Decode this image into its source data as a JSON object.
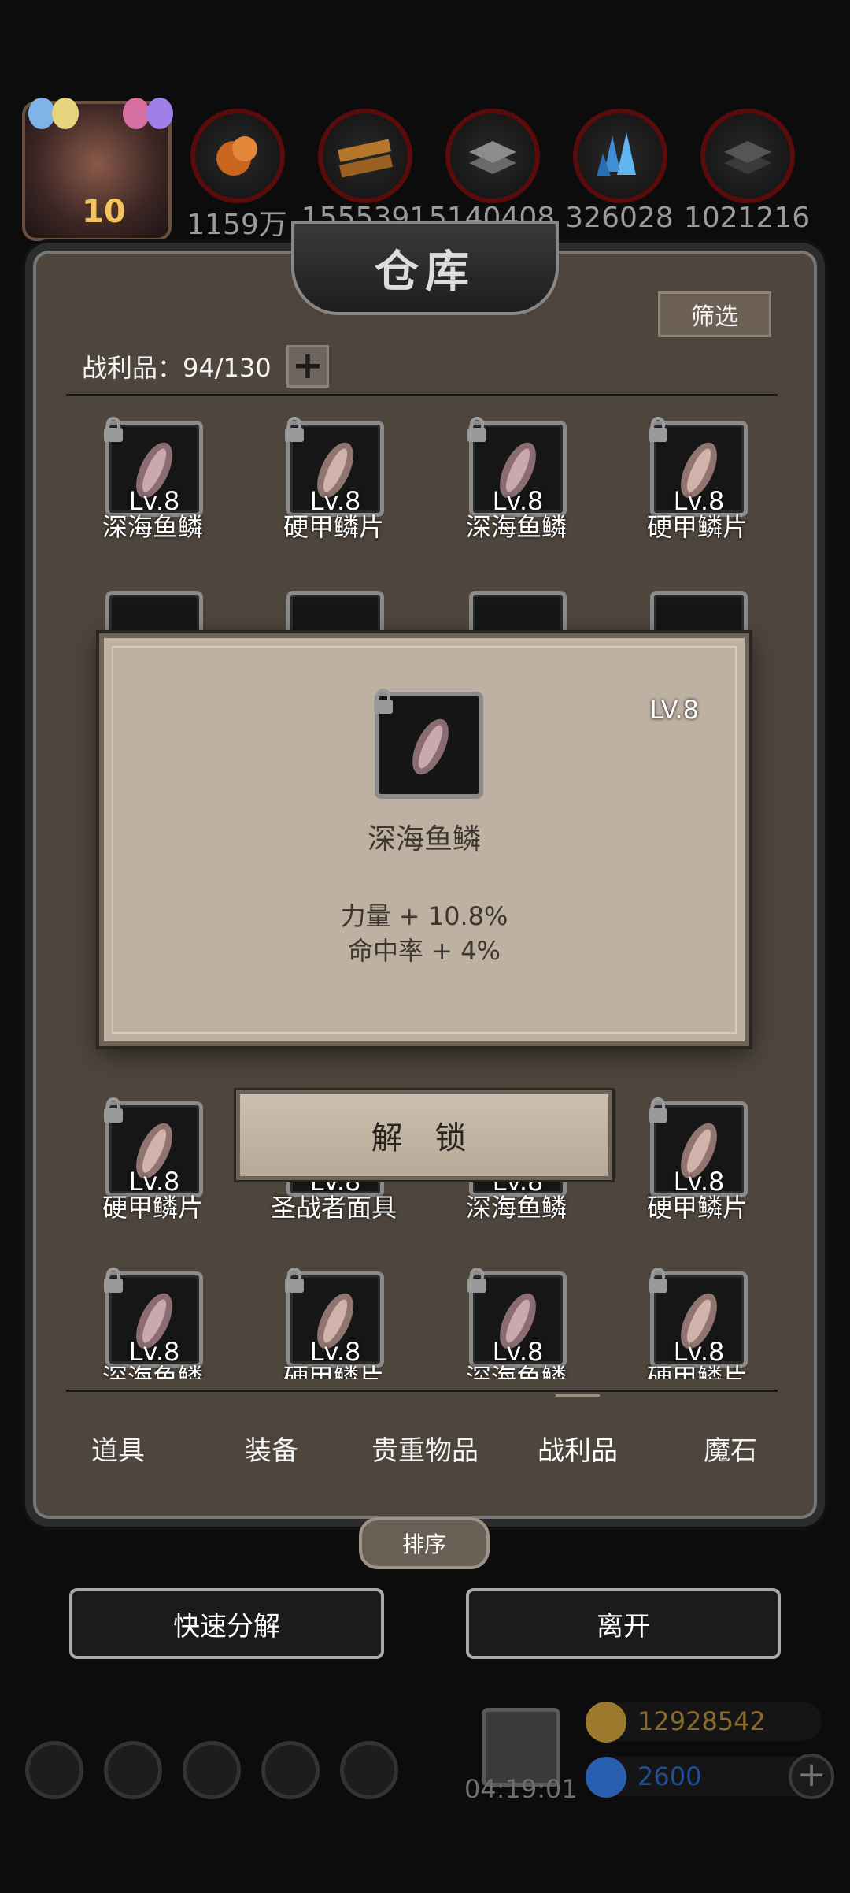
{
  "header": {
    "avatar_level": "10",
    "resources": [
      {
        "icon": "ore-orange-icon",
        "value": "1159万"
      },
      {
        "icon": "wood-planks-icon",
        "value": "1555391"
      },
      {
        "icon": "iron-ingot-icon",
        "value": "5140408"
      },
      {
        "icon": "blue-crystal-icon",
        "value": "326028"
      },
      {
        "icon": "dark-ingot-icon",
        "value": "1021216"
      }
    ]
  },
  "panel": {
    "title": "仓库",
    "filter_label": "筛选",
    "loot_count_label": "战利品：94/130",
    "add_slot_label": "+"
  },
  "items": [
    {
      "name": "深海鱼鳞",
      "level": "Lv.8"
    },
    {
      "name": "硬甲鳞片",
      "level": "Lv.8"
    },
    {
      "name": "深海鱼鳞",
      "level": "Lv.8"
    },
    {
      "name": "硬甲鳞片",
      "level": "Lv.8"
    },
    {
      "name": "硬甲鳞片",
      "level": "Lv.8"
    },
    {
      "name": "圣战者面具",
      "level": "Lv.8"
    },
    {
      "name": "深海鱼鳞",
      "level": "Lv.8"
    },
    {
      "name": "硬甲鳞片",
      "level": "Lv.8"
    },
    {
      "name": "深海鱼鳞",
      "level": "Lv.8"
    },
    {
      "name": "硬甲鳞片",
      "level": "Lv.8"
    },
    {
      "name": "深海鱼鳞",
      "level": "Lv.8"
    },
    {
      "name": "硬甲鳞片",
      "level": "Lv.8"
    }
  ],
  "popup": {
    "level": "LV.8",
    "name": "深海鱼鳞",
    "stats": [
      "力量 + 10.8%",
      "命中率 + 4%"
    ]
  },
  "unlock_label": "解 锁",
  "tabs": [
    "道具",
    "装备",
    "贵重物品",
    "战利品",
    "魔石"
  ],
  "active_tab": "战利品",
  "sort_label": "排序",
  "quick_dismantle_label": "快速分解",
  "leave_label": "离开",
  "hud": {
    "timer": "04:19:01",
    "gold": "12928542",
    "gems": "2600",
    "gold_color": "#8a6a2c",
    "gem_color": "#1f4f9a"
  }
}
